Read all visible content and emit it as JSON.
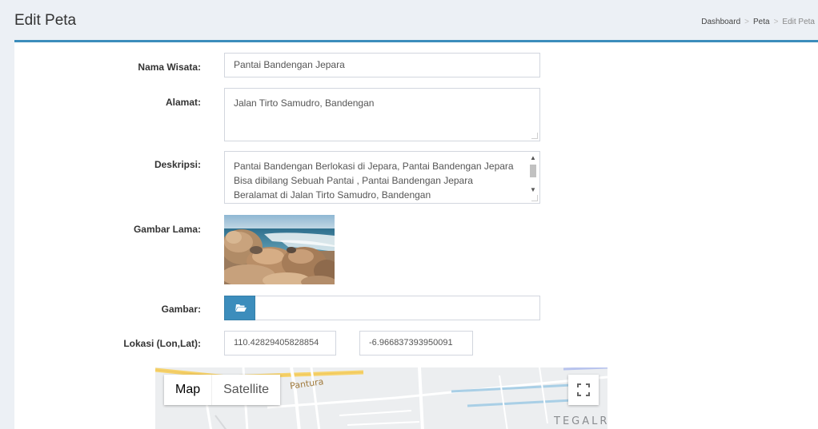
{
  "header": {
    "title": "Edit Peta",
    "breadcrumb": [
      "Dashboard",
      "Peta",
      "Edit Peta"
    ]
  },
  "form": {
    "nama_label": "Nama Wisata:",
    "nama_value": "Pantai Bandengan Jepara",
    "alamat_label": "Alamat:",
    "alamat_value": "Jalan Tirto Samudro, Bandengan",
    "deskripsi_label": "Deskripsi:",
    "deskripsi_value": "Pantai Bandengan Berlokasi di Jepara, Pantai Bandengan Jepara Bisa dibilang Sebuah Pantai , Pantai Bandengan Jepara Beralamat di Jalan Tirto Samudro, Bandengan",
    "gambar_lama_label": "Gambar Lama:",
    "gambar_label": "Gambar:",
    "lokasi_label": "Lokasi (Lon,Lat):",
    "lon_value": "110.42829405828854",
    "lat_value": "-6.966837393950091"
  },
  "map": {
    "map_label": "Map",
    "satellite_label": "Satellite",
    "place_pantura": "Pantura",
    "place_tegal": "TEGALR"
  },
  "icons": {
    "file_button": "folder-open-icon",
    "fullscreen": "fullscreen-icon"
  },
  "colors": {
    "accent": "#3c8dbc",
    "page_bg": "#ecf0f5",
    "border": "#d2d6de"
  }
}
